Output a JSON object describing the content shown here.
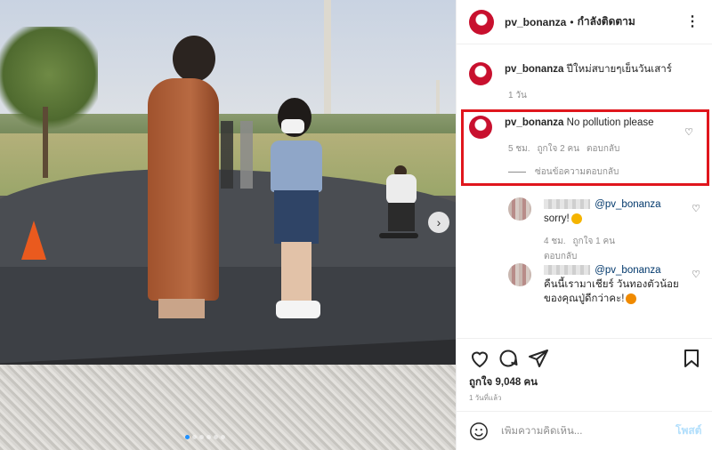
{
  "post": {
    "username": "pv_bonanza",
    "separator": "•",
    "follow_status": "กำลังติดตาม",
    "caption": {
      "username": "pv_bonanza",
      "text": "ปีใหม่สบายๆเย็นวันเสาร์",
      "time": "1 วัน"
    },
    "highlighted_comment": {
      "username": "pv_bonanza",
      "text": "No pollution please",
      "time": "5 ชม.",
      "likes": "ถูกใจ 2 คน",
      "reply": "ตอบกลับ",
      "hide_replies": "ซ่อนข้อความตอบกลับ"
    },
    "replies": [
      {
        "mention": "@pv_bonanza",
        "text": "sorry!",
        "time": "4 ชม.",
        "likes": "ถูกใจ 1 คน",
        "reply": "ตอบกลับ"
      },
      {
        "mention": "@pv_bonanza",
        "text": "คืนนี้เรามาเชียร์ วันทองตัวน้อยของคุณปู่ดีกว่าคะ!"
      }
    ],
    "likes_count": "ถูกใจ 9,048 คน",
    "posted_ago": "1 วันที่แล้ว",
    "comment_placeholder": "เพิ่มความคิดเห็น...",
    "post_button": "โพสต์",
    "carousel_next": "›",
    "colors": {
      "highlight_border": "#e0161d",
      "avatar": "#c8102e",
      "mention": "#00376b",
      "post_button": "#b2dffc"
    },
    "icons": [
      "more-icon",
      "heart-icon",
      "comment-icon",
      "share-icon",
      "bookmark-icon",
      "emoji-icon",
      "next-arrow-icon"
    ]
  }
}
